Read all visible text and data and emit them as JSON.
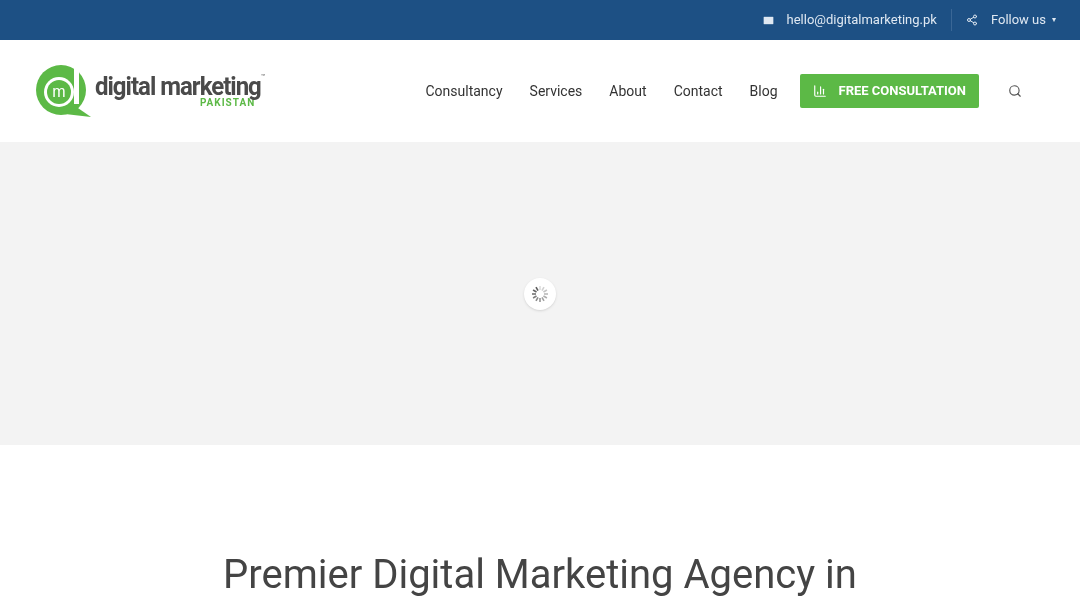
{
  "top_bar": {
    "email": "hello@digitalmarketing.pk",
    "follow": "Follow us",
    "follow_caret": "▾"
  },
  "logo": {
    "mark_letter": "m",
    "name": "digital marketing",
    "trademark": "™",
    "country": "PAKISTAN"
  },
  "nav": {
    "items": [
      {
        "label": "Consultancy"
      },
      {
        "label": "Services"
      },
      {
        "label": "About"
      },
      {
        "label": "Contact"
      },
      {
        "label": "Blog"
      }
    ],
    "cta": "FREE CONSULTATION"
  },
  "hero": {
    "loading": true
  },
  "heading": "Premier Digital Marketing Agency in"
}
